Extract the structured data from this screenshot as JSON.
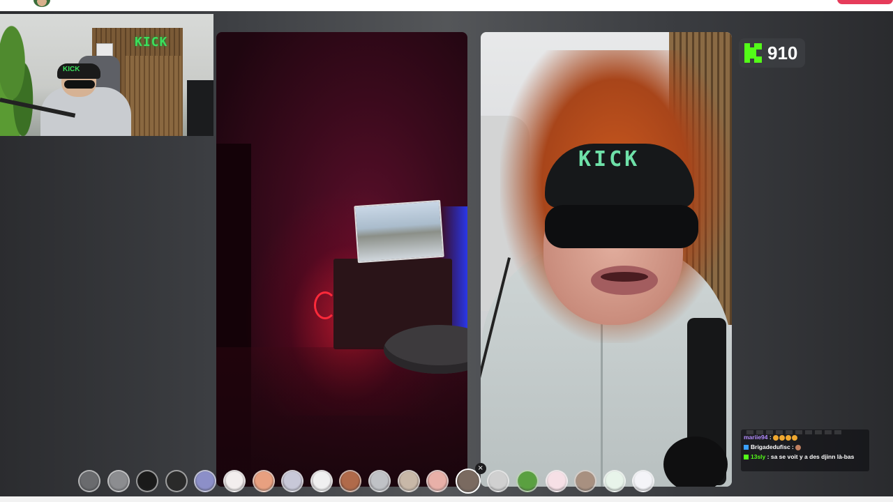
{
  "overlay": {
    "viewer_count": "910",
    "viewer_icon": "kick-logo-icon",
    "brand_color": "#53fc18"
  },
  "webcam": {
    "sign_text": "KICK",
    "cap_text": "KICK"
  },
  "right_panel": {
    "cap_text": "KICK"
  },
  "chat": {
    "messages": [
      {
        "user": "mariie94",
        "sep": " : ",
        "text": "",
        "user_color": "#b48cff",
        "emotes": [
          "#f0a830",
          "#f0a830",
          "#f0a830",
          "#f0a830"
        ],
        "badge_color": ""
      },
      {
        "user": "Brigadedufisc",
        "sep": " : ",
        "text": "",
        "user_color": "#ffffff",
        "emotes": [
          "#c08060"
        ],
        "badge_color": "#3aa0ff"
      },
      {
        "user": "13sly",
        "sep": " : ",
        "text": "sa se voit y a des djinn là-bas",
        "user_color": "#53fc18",
        "emotes": [],
        "badge_color": "#53fc18"
      }
    ]
  },
  "effects": {
    "items": [
      {
        "name": "effect-none-icon",
        "color": "#6a6b6e",
        "selected": false
      },
      {
        "name": "effect-sad-face-icon",
        "color": "#8c8d90",
        "selected": false
      },
      {
        "name": "effect-devil-icon",
        "color": "#1a1a1a",
        "selected": false
      },
      {
        "name": "effect-speed-icon",
        "color": "#2a2a2a",
        "selected": false
      },
      {
        "name": "effect-blur-icon",
        "color": "#8c8fc8",
        "selected": false
      },
      {
        "name": "effect-sheep-icon",
        "color": "#f2eeee",
        "selected": false
      },
      {
        "name": "effect-peach-icon",
        "color": "#e8a080",
        "selected": false
      },
      {
        "name": "effect-robot-icon",
        "color": "#c8c8d8",
        "selected": false
      },
      {
        "name": "effect-panda-icon",
        "color": "#f0f0f0",
        "selected": false
      },
      {
        "name": "effect-man-face-icon",
        "color": "#b06a4a",
        "selected": false
      },
      {
        "name": "effect-ghost-icon",
        "color": "#c0c2c6",
        "selected": false
      },
      {
        "name": "effect-mustache-icon",
        "color": "#c8b8a8",
        "selected": false
      },
      {
        "name": "effect-blush-icon",
        "color": "#e8b0a8",
        "selected": false
      },
      {
        "name": "effect-wig-icon",
        "color": "#7a6a60",
        "selected": true
      },
      {
        "name": "effect-grey-face-icon",
        "color": "#d0d0d0",
        "selected": false
      },
      {
        "name": "effect-alien-icon",
        "color": "#5aa040",
        "selected": false
      },
      {
        "name": "effect-pig-icon",
        "color": "#f6e0e6",
        "selected": false
      },
      {
        "name": "effect-donkey-icon",
        "color": "#a89080",
        "selected": false
      },
      {
        "name": "effect-green-cat-icon",
        "color": "#e8f4ea",
        "selected": false
      },
      {
        "name": "effect-stars-icon",
        "color": "#f4f4f8",
        "selected": false
      }
    ],
    "close_glyph": "×"
  }
}
